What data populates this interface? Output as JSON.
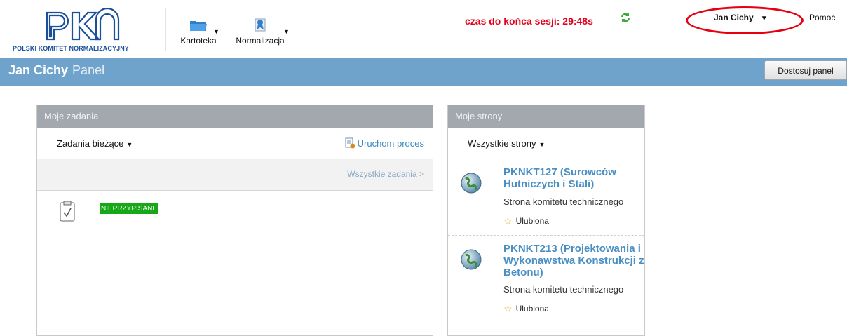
{
  "header": {
    "logo_text": "POLSKI KOMITET NORMALIZACYJNY",
    "menu": [
      {
        "label": "Kartoteka",
        "icon": "folder-icon"
      },
      {
        "label": "Normalizacja",
        "icon": "standards-icon"
      }
    ],
    "session_timer": "czas do końca sesji: 29:48s",
    "user_name": "Jan Cichy",
    "help_label": "Pomoc"
  },
  "page": {
    "user": "Jan Cichy",
    "title": "Panel",
    "customize_button": "Dostosuj panel"
  },
  "tasks_panel": {
    "title": "Moje zadania",
    "filter": "Zadania bieżące",
    "start_process": "Uruchom proces",
    "all_tasks_link": "Wszystkie zadania >",
    "tasks": [
      {
        "status": "NIEPRZYPISANE",
        "status_color": "#17a817"
      }
    ]
  },
  "sites_panel": {
    "title": "Moje strony",
    "filter": "Wszystkie strony",
    "sites": [
      {
        "name": "PKNKT127 (Surowców Hutniczych i Stali)",
        "description": "Strona komitetu technicznego",
        "favorite_label": "Ulubiona"
      },
      {
        "name": "PKNKT213 (Projektowania i Wykonawstwa Konstrukcji z Betonu)",
        "description": "Strona komitetu technicznego",
        "favorite_label": "Ulubiona"
      }
    ]
  },
  "colors": {
    "accent_bar": "#6fa3cc",
    "session_red": "#e3001b",
    "link_blue": "#4a8fc4",
    "highlight_ellipse": "#e60012"
  }
}
